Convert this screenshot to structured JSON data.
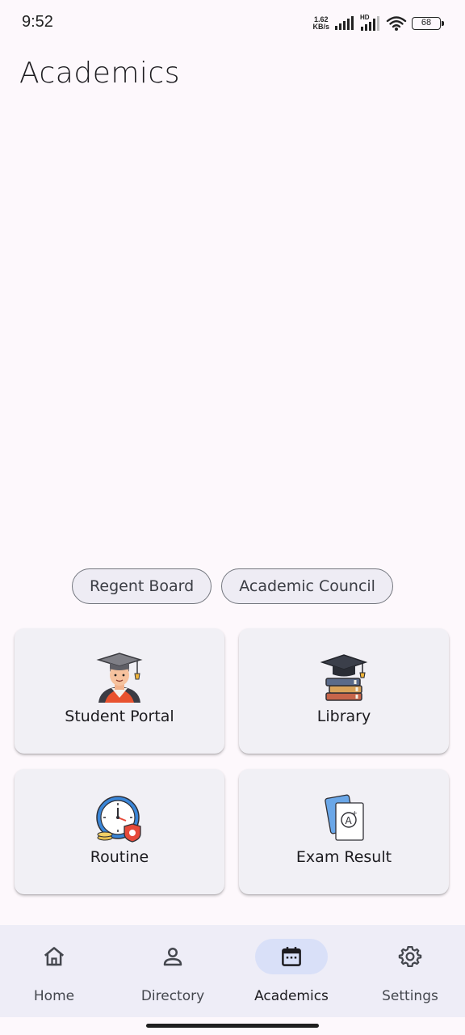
{
  "status_bar": {
    "time": "9:52",
    "net_speed_value": "1.62",
    "net_speed_unit": "KB/s",
    "hd_badge": "HD",
    "battery": "68"
  },
  "page": {
    "title": "Academics"
  },
  "chips": [
    {
      "label": "Regent Board"
    },
    {
      "label": "Academic Council"
    }
  ],
  "cards": [
    {
      "label": "Student Portal",
      "icon": "graduate-student-icon"
    },
    {
      "label": "Library",
      "icon": "books-graduation-cap-icon"
    },
    {
      "label": "Routine",
      "icon": "clock-schedule-icon"
    },
    {
      "label": "Exam Result",
      "icon": "grade-paper-icon"
    }
  ],
  "bottom_nav": {
    "items": [
      {
        "label": "Home",
        "icon": "home-icon",
        "active": false
      },
      {
        "label": "Directory",
        "icon": "person-icon",
        "active": false
      },
      {
        "label": "Academics",
        "icon": "calendar-icon",
        "active": true
      },
      {
        "label": "Settings",
        "icon": "gear-icon",
        "active": false
      }
    ]
  },
  "colors": {
    "background": "#fdf8fc",
    "card": "#f1f0f5",
    "nav_bar": "#eeedf7",
    "nav_active_pill": "#d9e0f8"
  }
}
